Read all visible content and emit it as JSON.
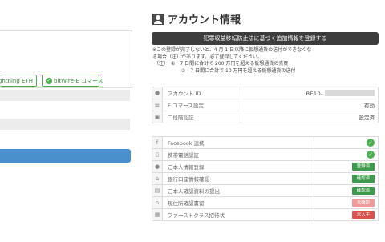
{
  "left_panel": {
    "tag_eth": "Lightning ETH",
    "tag_ec": "bitWire-E コマース"
  },
  "page_title": "アカウント情報",
  "register_button": "犯罪収益移転防止法に基づく追加情報を登録する",
  "notice": {
    "line1": "※この登録が完了しないと、4 月 1 日以降に仮想通貨の送付ができなくな",
    "line2": "る場合（注）があります。必ず登録してください。",
    "line3": "（注）　①　7 日間に合計で 200 万円を超える仮想通貨の売買",
    "line4": "②　7 日間に合計で 10 万円を超える仮想通貨の送付"
  },
  "account": {
    "id_label": "アカウント ID",
    "id_value": "BF10-",
    "ec_label": "E コマース設定",
    "ec_value": "有効",
    "twofa_label": "二段階認証",
    "twofa_value": "設定済"
  },
  "verifications": [
    {
      "label": "Facebook 連携",
      "status": ""
    },
    {
      "label": "携帯電話認証",
      "status": ""
    },
    {
      "label": "ご本人情報登録",
      "status": "登録済"
    },
    {
      "label": "銀行口座情報確認",
      "status": "確認済"
    },
    {
      "label": "ご本人確認資料の提出",
      "status": "確認済"
    },
    {
      "label": "現住所確認書留",
      "status": "未確認"
    },
    {
      "label": "ファーストクラス招待状",
      "status": "未入手"
    }
  ],
  "icons": {
    "check": "✓"
  }
}
